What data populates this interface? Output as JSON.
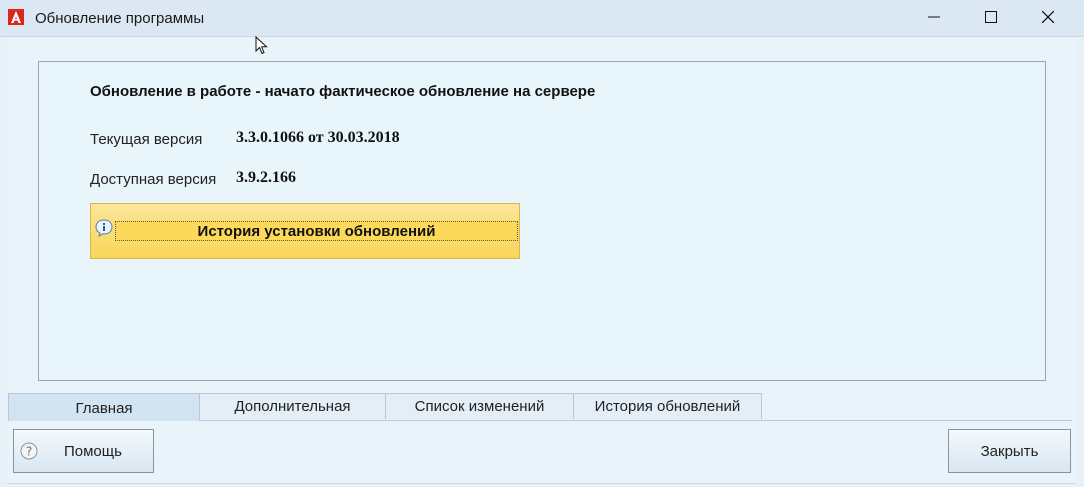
{
  "window": {
    "title": "Обновление программы"
  },
  "main": {
    "status_text": "Обновление в работе - начато фактическое обновление на сервере",
    "current_version_label": "Текущая версия",
    "current_version_value": "3.3.0.1066 от 30.03.2018",
    "available_version_label": "Доступная версия",
    "available_version_value": "3.9.2.166",
    "history_button_label": "История установки обновлений"
  },
  "tabs": [
    {
      "label": "Главная",
      "active": true
    },
    {
      "label": "Дополнительная",
      "active": false
    },
    {
      "label": "Список изменений",
      "active": false
    },
    {
      "label": "История обновлений",
      "active": false
    }
  ],
  "footer": {
    "help_label": "Помощь",
    "close_label": "Закрыть"
  },
  "icons": {
    "app": "app-logo-icon",
    "minimize": "minimize-icon",
    "maximize": "maximize-icon",
    "close": "close-icon",
    "info": "info-icon",
    "help": "question-icon"
  },
  "colors": {
    "app_icon_red": "#d62a1e",
    "history_button_fill": "#fcd95b",
    "background": "#e8f4fa"
  }
}
